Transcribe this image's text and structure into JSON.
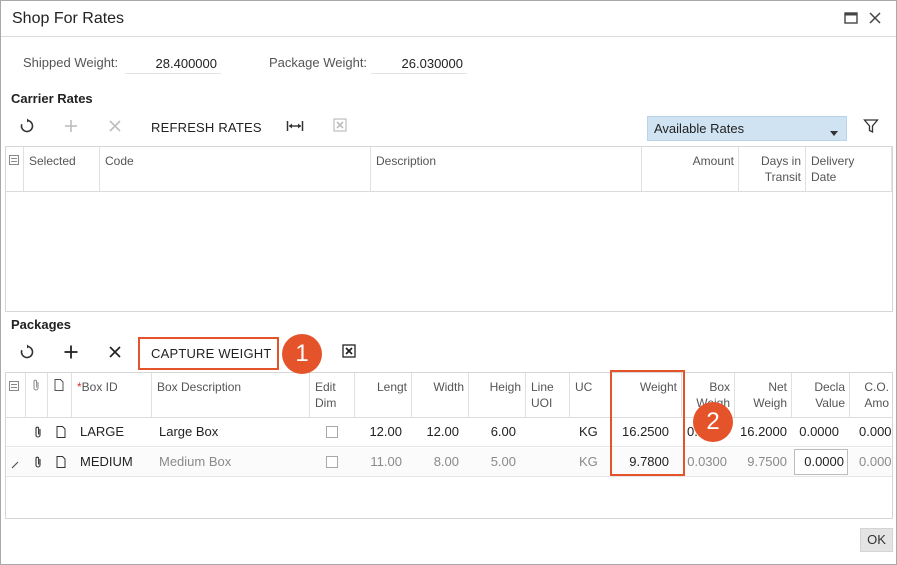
{
  "window": {
    "title": "Shop For Rates"
  },
  "summary": {
    "shipped_weight_label": "Shipped Weight:",
    "shipped_weight_value": "28.400000",
    "package_weight_label": "Package Weight:",
    "package_weight_value": "26.030000"
  },
  "carrier_rates": {
    "section_title": "Carrier Rates",
    "refresh_label": "REFRESH RATES",
    "rates_filter": "Available Rates",
    "columns": [
      "Selected",
      "Code",
      "Description",
      "Amount",
      "Days in Transit",
      "Delivery Date"
    ],
    "days_in": "Days in",
    "transit": "Transit",
    "delivery": "Delivery",
    "date": "Date"
  },
  "packages": {
    "section_title": "Packages",
    "capture_weight_label": "CAPTURE WEIGHT",
    "columns": {
      "box_id": "Box ID",
      "box_description": "Box Description",
      "edit_dim_1": "Edit",
      "edit_dim_2": "Dim",
      "length": "Lengt",
      "width": "Width",
      "height": "Heigh",
      "line_uom_1": "Line",
      "line_uom_2": "UOI",
      "uom": "UC",
      "weight": "Weight",
      "box_weight_1": "Box",
      "box_weight_2": "Weigh",
      "net_weight_1": "Net",
      "net_weight_2": "Weigh",
      "declared_value_1": "Decla",
      "declared_value_2": "Value",
      "cod_amount_1": "C.O.",
      "cod_amount_2": "Amo"
    },
    "rows": [
      {
        "box_id": "LARGE",
        "box_description": "Large Box",
        "length": "12.00",
        "width": "12.00",
        "height": "6.00",
        "uom": "KG",
        "weight": "16.2500",
        "box_weight": "0.0",
        "net_weight": "16.2000",
        "declared_value": "0.0000",
        "cod_amount": "0.0000"
      },
      {
        "box_id": "MEDIUM",
        "box_description": "Medium Box",
        "length": "11.00",
        "width": "8.00",
        "height": "5.00",
        "uom": "KG",
        "weight": "9.7800",
        "box_weight": "0.0300",
        "net_weight": "9.7500",
        "declared_value": "0.0000",
        "cod_amount": "0.0000"
      }
    ]
  },
  "callouts": {
    "one": "1",
    "two": "2"
  },
  "footer": {
    "ok_label": "OK"
  },
  "colors": {
    "accent": "#e5532b",
    "select_bg": "#cfe3f3"
  }
}
